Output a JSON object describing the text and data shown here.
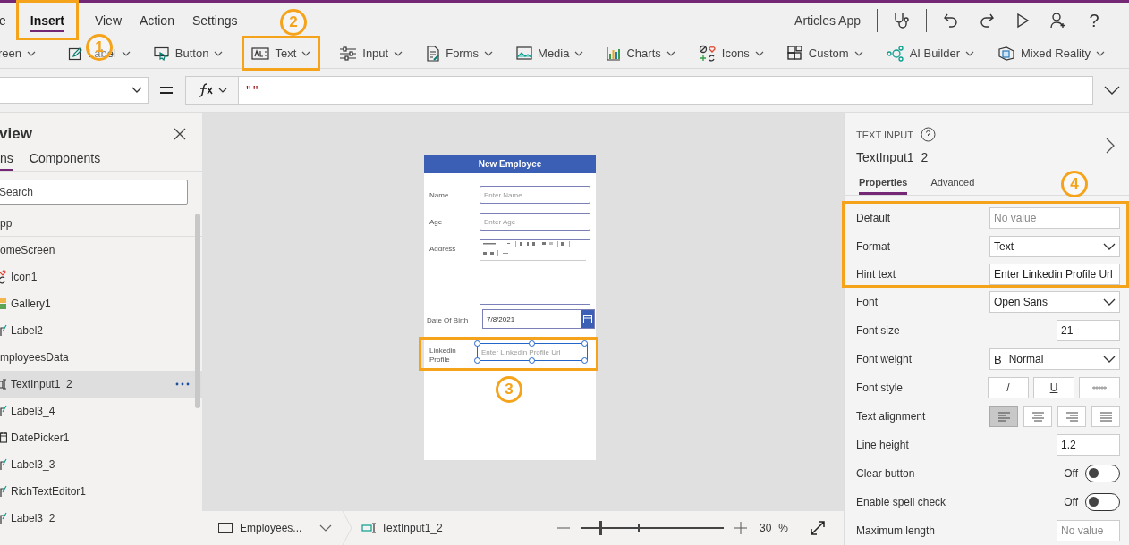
{
  "menu": {
    "tabs": [
      {
        "label": "e",
        "selected": false,
        "highlighted": false
      },
      {
        "label": "Insert",
        "selected": true,
        "highlighted": true
      },
      {
        "label": "View",
        "selected": false,
        "highlighted": false
      },
      {
        "label": "Action",
        "selected": false,
        "highlighted": false
      },
      {
        "label": "Settings",
        "selected": false,
        "highlighted": false
      }
    ],
    "app_name": "Articles App",
    "actions": [
      {
        "kind": "stethoscope"
      },
      {
        "kind": "undo"
      },
      {
        "kind": "redo"
      },
      {
        "kind": "play"
      },
      {
        "kind": "add-user"
      },
      {
        "kind": "help",
        "glyph": "?"
      }
    ]
  },
  "toolbar": {
    "items": [
      {
        "kind": "screen",
        "label": "reen",
        "highlighted": false
      },
      {
        "kind": "label",
        "label": "Label",
        "highlighted": false
      },
      {
        "kind": "button",
        "label": "Button",
        "highlighted": false
      },
      {
        "kind": "text",
        "label": "Text",
        "highlighted": true
      },
      {
        "kind": "input",
        "label": "Input",
        "highlighted": false
      },
      {
        "kind": "forms",
        "label": "Forms",
        "highlighted": false
      },
      {
        "kind": "media",
        "label": "Media",
        "highlighted": false
      },
      {
        "kind": "charts",
        "label": "Charts",
        "highlighted": false
      },
      {
        "kind": "icons",
        "label": "Icons",
        "highlighted": false
      },
      {
        "kind": "custom",
        "label": "Custom",
        "highlighted": false
      },
      {
        "kind": "ai",
        "label": "AI Builder",
        "highlighted": false
      },
      {
        "kind": "mixed",
        "label": "Mixed Reality",
        "highlighted": false
      }
    ]
  },
  "formula": {
    "value": "\"\""
  },
  "tree": {
    "title": "view",
    "tabs": [
      {
        "label": "ns",
        "selected": true
      },
      {
        "label": "Components",
        "selected": false
      }
    ],
    "search_placeholder": "Search",
    "items": [
      {
        "label": "pp",
        "kind": "app",
        "selected": false
      },
      {
        "label": "omeScreen",
        "kind": "screen",
        "selected": false,
        "children": [
          {
            "label": "Icon1",
            "kind": "icon",
            "selected": false
          },
          {
            "label": "Gallery1",
            "kind": "gallery",
            "selected": false
          },
          {
            "label": "Label2",
            "kind": "label",
            "selected": false
          }
        ]
      },
      {
        "label": "mployeesData",
        "kind": "screen",
        "selected": false,
        "children": [
          {
            "label": "TextInput1_2",
            "kind": "textinput",
            "selected": true
          },
          {
            "label": "Label3_4",
            "kind": "label",
            "selected": false
          },
          {
            "label": "DatePicker1",
            "kind": "datepicker",
            "selected": false
          },
          {
            "label": "Label3_3",
            "kind": "label",
            "selected": false
          },
          {
            "label": "RichTextEditor1",
            "kind": "richtext",
            "selected": false
          },
          {
            "label": "Label3_2",
            "kind": "label",
            "selected": false
          }
        ]
      }
    ]
  },
  "form": {
    "title": "New Employee",
    "fields": [
      {
        "kind": "input",
        "label": "Name",
        "placeholder": "Enter Name",
        "selected": false,
        "highlighted": false
      },
      {
        "kind": "input",
        "label": "Age",
        "placeholder": "Enter Age",
        "selected": false,
        "highlighted": false
      },
      {
        "kind": "richtext",
        "label": "Address",
        "selected": false,
        "highlighted": false
      },
      {
        "kind": "date",
        "label": "Date Of Birth",
        "value": "7/8/2021",
        "selected": false,
        "highlighted": false
      },
      {
        "kind": "input",
        "label": "Linkedin Profile",
        "placeholder": "Enter Linkedin Profile Url",
        "selected": true,
        "highlighted": true
      }
    ]
  },
  "status_bar": {
    "screen": "Employees...",
    "breadcrumb": "TextInput1_2",
    "zoom": {
      "level": 0.14,
      "reading": "30",
      "unit": "%"
    }
  },
  "properties": {
    "type_label": "TEXT INPUT",
    "name": "TextInput1_2",
    "tabs": [
      {
        "label": "Properties",
        "selected": true
      },
      {
        "label": "Advanced",
        "selected": false
      }
    ],
    "rows": [
      {
        "label": "Default",
        "kind": "input",
        "placeholder": "No value",
        "highlighted": true
      },
      {
        "label": "Format",
        "kind": "dropdown",
        "value": "Text",
        "highlighted": true
      },
      {
        "label": "Hint text",
        "kind": "input",
        "value": "Enter Linkedin Profile Url",
        "highlighted": true
      },
      {
        "label": "Font",
        "kind": "dropdown",
        "value": "Open Sans",
        "highlighted": false
      },
      {
        "label": "Font size",
        "kind": "number",
        "value": "21",
        "highlighted": false
      },
      {
        "label": "Font weight",
        "kind": "dropdown",
        "prefix": "B",
        "value": "Normal",
        "highlighted": false
      },
      {
        "label": "Font style",
        "kind": "style_buttons",
        "highlighted": false,
        "buttons": [
          {
            "kind": "italic",
            "label": "/"
          },
          {
            "kind": "underline",
            "label": "U"
          },
          {
            "kind": "strike"
          }
        ]
      },
      {
        "label": "Text alignment",
        "kind": "align_buttons",
        "highlighted": false,
        "buttons": [
          {
            "kind": "left",
            "selected": true
          },
          {
            "kind": "center",
            "selected": false
          },
          {
            "kind": "right",
            "selected": false
          },
          {
            "kind": "justify",
            "selected": false
          }
        ]
      },
      {
        "label": "Line height",
        "kind": "number",
        "value": "1.2",
        "highlighted": false
      },
      {
        "label": "Clear button",
        "kind": "toggle",
        "on": false,
        "reading": "Off",
        "highlighted": false
      },
      {
        "label": "Enable spell check",
        "kind": "toggle",
        "on": false,
        "reading": "Off",
        "highlighted": false
      },
      {
        "label": "Maximum length",
        "kind": "number",
        "placeholder": "No value",
        "highlighted": false
      }
    ]
  },
  "callouts": [
    {
      "number": "1"
    },
    {
      "number": "2"
    },
    {
      "number": "3"
    },
    {
      "number": "4"
    }
  ]
}
